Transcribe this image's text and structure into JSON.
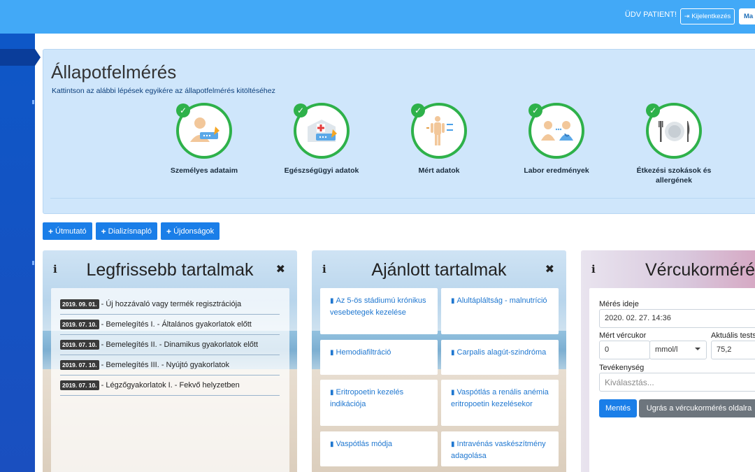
{
  "header": {
    "greeting": "ÜDV PATIENT!",
    "logout_label": "Kijelentkezés",
    "right_button_label": "Ma"
  },
  "assessment": {
    "title": "Állapotfelmérés",
    "subtitle": "Kattintson az alábbi lépések egyikére az állapotfelmérés kitöltéséhez",
    "steps": [
      {
        "label": "Személyes adataim",
        "completed": true,
        "icon": "person-form-icon"
      },
      {
        "label": "Egészségügyi adatok",
        "completed": true,
        "icon": "hospital-form-icon"
      },
      {
        "label": "Mért adatok",
        "completed": true,
        "icon": "body-measure-icon"
      },
      {
        "label": "Labor eredmények",
        "completed": true,
        "icon": "patient-doctor-icon"
      },
      {
        "label": "Étkezési szokások és allergének",
        "completed": true,
        "icon": "plate-cutlery-icon"
      }
    ]
  },
  "actions": [
    {
      "label": "Útmutató"
    },
    {
      "label": "Dializísnapló"
    },
    {
      "label": "Újdonságok"
    }
  ],
  "latest": {
    "title": "Legfrissebb tartalmak",
    "info": "i",
    "items": [
      {
        "date": "2019. 09. 01.",
        "text": "- Új hozzávaló vagy termék regisztrációja"
      },
      {
        "date": "2019. 07. 10.",
        "text": "- Bemelegítés I. - Általános gyakorlatok előtt"
      },
      {
        "date": "2019. 07. 10.",
        "text": "- Bemelegítés II. - Dinamikus gyakorlatok előtt"
      },
      {
        "date": "2019. 07. 10.",
        "text": "- Bemelegítés III. - Nyújtó gyakorlatok"
      },
      {
        "date": "2019. 07. 10.",
        "text": "- Légzőgyakorlatok I. - Fekvő helyzetben"
      }
    ]
  },
  "recommended": {
    "title": "Ajánlott tartalmak",
    "info": "i",
    "items": [
      {
        "text": "Az 5-ös stádiumú krónikus vesebetegek kezelése"
      },
      {
        "text": "Alultápláltság - malnutríció"
      },
      {
        "text": "Hemodiafiltráció"
      },
      {
        "text": "Carpalis alagút-szindróma"
      },
      {
        "text": "Eritropoetin kezelés indikációja"
      },
      {
        "text": "Vaspótlás a renális anémia eritropoetin kezelésekor"
      },
      {
        "text": "Vaspótlás módja"
      },
      {
        "text": "Intravénás vaskészítmény adagolása"
      }
    ]
  },
  "glucose": {
    "title": "Vércukormérés",
    "info": "i",
    "time_label": "Mérés ideje",
    "time_value": "2020. 02. 27. 14:36",
    "glucose_label": "Mért vércukor",
    "glucose_value": "0",
    "unit_value": "mmol/l",
    "weight_label": "Aktuális tests",
    "weight_value": "75,2",
    "activity_label": "Tevékenység",
    "activity_placeholder": "Kiválasztás...",
    "save_label": "Mentés",
    "goto_label": "Ugrás a vércukormérés oldalra"
  },
  "colors": {
    "topbar": "#42a9f7",
    "sidebar": "#0e57c7",
    "primary": "#1a7ee8",
    "success": "#2eb14a",
    "panel": "#cfe6fb"
  }
}
